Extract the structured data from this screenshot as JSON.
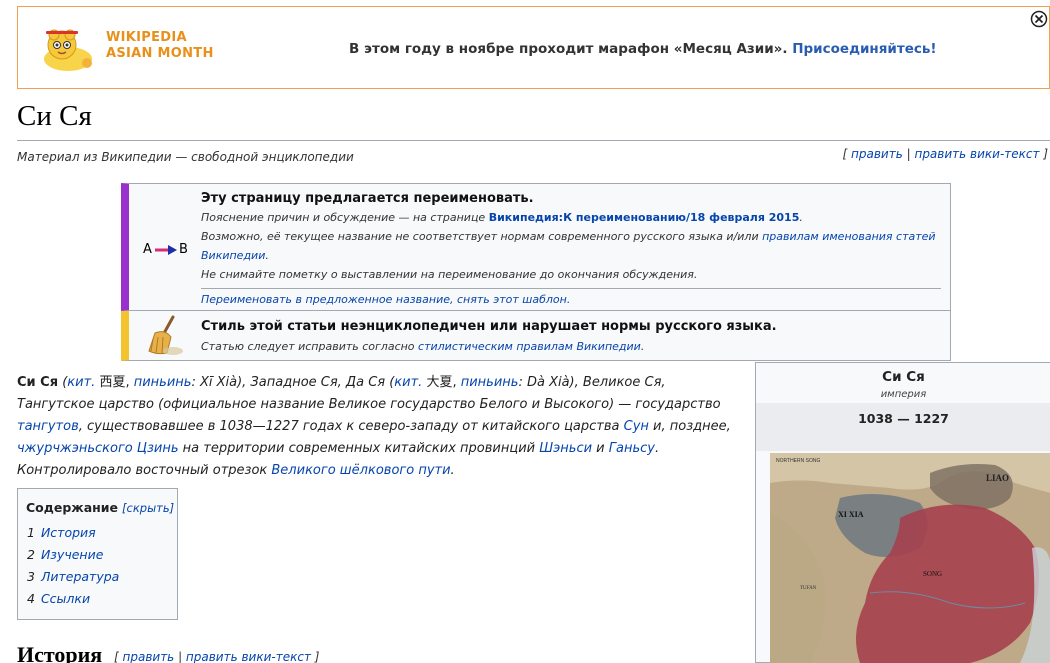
{
  "banner": {
    "logo_line1": "WIKIPEDIA",
    "logo_line2": "ASIAN MONTH",
    "text": "В этом году в ноябре проходит марафон «Месяц Азии».",
    "link": "Присоединяйтесь!"
  },
  "article": {
    "title": "Си Ся",
    "tagline": "Материал из Википедии — свободной энциклопедии",
    "edit": "править",
    "edit_source": "править вики-текст"
  },
  "rename_box": {
    "icon_left": "A",
    "icon_right": "B",
    "title": "Эту страницу предлагается переименовать.",
    "line1_text": "Пояснение причин и обсуждение — на странице ",
    "line1_link": "Википедия:К переименованию/18 февраля 2015",
    "line1_end": ".",
    "line2_text": "Возможно, её текущее название не соответствует нормам современного русского языка и/или ",
    "line2_link": "правилам именования статей",
    "line3_link": "Википедии",
    "line3_end": ".",
    "line4_text": "Не снимайте пометку о выставлении на переименование до окончания обсуждения.",
    "action_link": "Переименовать в предложенное название, снять этот шаблон."
  },
  "style_box": {
    "title": "Стиль этой статьи неэнциклопедичен или нарушает нормы русского языка.",
    "text": "Статью следует исправить согласно ",
    "link": "стилистическим правилам Википедии",
    "end": "."
  },
  "lead": {
    "bold_name": "Си Ся",
    "p1": " (",
    "kit1": "кит.",
    "p2": " 西夏, ",
    "pinyin1": "пиньинь",
    "p3": ": Xī Xià), Западное Ся, Да Ся (",
    "kit2": "кит.",
    "p4": " 大夏, ",
    "pinyin2": "пиньинь",
    "p5": ": Dà Xià), Великое Ся, Тангутское царство (официальное название Великое государство Белого и Высокого) — государство ",
    "tanguts": "тангутов",
    "p6": ", существовавшее в 1038—1227 годах к северо-западу от китайского царства ",
    "sun": "Сун",
    "p7": " и, позднее, ",
    "jin": "чжурчжэньского Цзинь",
    "p8": " на территории современных китайских провинций ",
    "shaanxi": "Шэньси",
    "p9": " и ",
    "gansu": "Ганьсу",
    "p10": ". Контролировало восточный отрезок ",
    "silk": "Великого шёлкового пути",
    "p11": "."
  },
  "toc": {
    "title": "Содержание",
    "hide": "[скрыть]",
    "items": [
      {
        "num": "1",
        "label": "История"
      },
      {
        "num": "2",
        "label": "Изучение"
      },
      {
        "num": "3",
        "label": "Литература"
      },
      {
        "num": "4",
        "label": "Ссылки"
      }
    ]
  },
  "section": {
    "heading": "История",
    "edit": "править",
    "edit_source": "править вики-текст"
  },
  "infobox": {
    "title": "Си Ся",
    "subtitle": "империя",
    "years": "1038 — 1227",
    "map_labels": [
      "NORTHERN SONG",
      "LIAO",
      "XI XIA",
      "SONG",
      "TUFAN"
    ]
  },
  "colors": {
    "rename_bar": "#9932cc",
    "style_bar": "#f4c430",
    "banner_border": "#f0a050",
    "link": "#0645ad",
    "map_song": "#a5404e"
  },
  "icons": [
    "close-icon",
    "rename-arrow-icon",
    "broom-icon",
    "asian-month-mascot-icon"
  ]
}
